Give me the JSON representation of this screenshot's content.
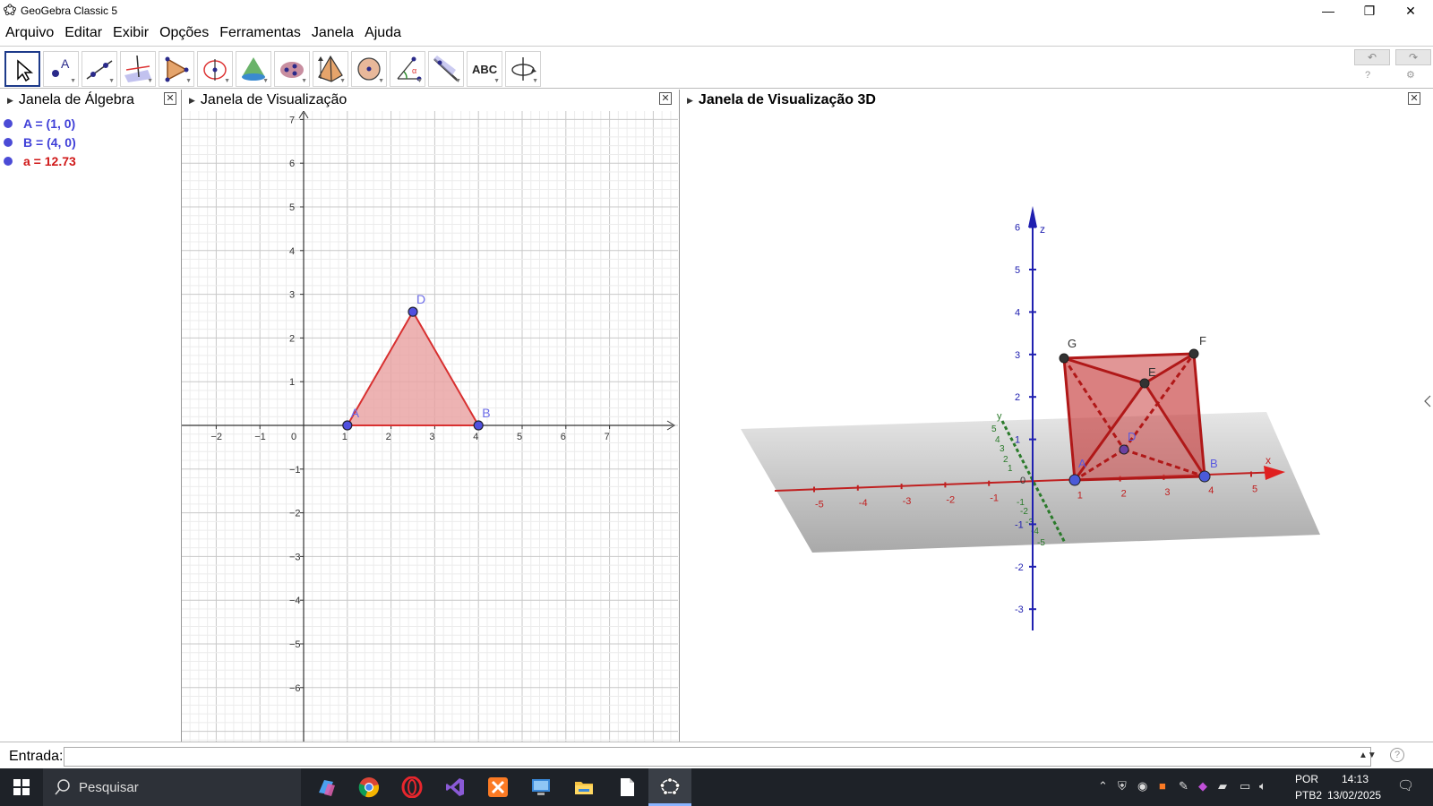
{
  "window": {
    "title": "GeoGebra Classic 5",
    "minimize": "—",
    "maximize": "❐",
    "close": "✕"
  },
  "menu": [
    "Arquivo",
    "Editar",
    "Exibir",
    "Opções",
    "Ferramentas",
    "Janela",
    "Ajuda"
  ],
  "toolbar": {
    "tools": [
      {
        "name": "move-tool-icon",
        "selected": true
      },
      {
        "name": "point-tool-icon"
      },
      {
        "name": "line-tool-icon"
      },
      {
        "name": "perpendicular-tool-icon"
      },
      {
        "name": "polygon-tool-icon"
      },
      {
        "name": "circle-tool-icon"
      },
      {
        "name": "cone-tool-icon"
      },
      {
        "name": "sphere-tool-icon"
      },
      {
        "name": "pyramid-tool-icon"
      },
      {
        "name": "circle-point-tool-icon"
      },
      {
        "name": "angle-tool-icon"
      },
      {
        "name": "reflect-tool-icon"
      },
      {
        "name": "text-tool-icon",
        "label": "ABC"
      },
      {
        "name": "rotate-view-tool-icon"
      }
    ],
    "undo": "↶",
    "redo": "↷",
    "help": "?",
    "settings": "⚙"
  },
  "panels": {
    "algebra": {
      "title": "Janela de Álgebra"
    },
    "graphics2d": {
      "title": "Janela de Visualização"
    },
    "graphics3d": {
      "title": "Janela de Visualização 3D"
    }
  },
  "algebra_items": [
    {
      "text": "A = (1, 0)",
      "color": "#4040d8"
    },
    {
      "text": "B = (4, 0)",
      "color": "#4040d8"
    },
    {
      "text": "a = 12.73",
      "color": "#d01818"
    }
  ],
  "graphics2d": {
    "x_ticks": [
      "−2",
      "−1",
      "0",
      "1",
      "2",
      "3",
      "4",
      "5",
      "6",
      "7"
    ],
    "y_ticks": [
      "7",
      "6",
      "5",
      "4",
      "3",
      "2",
      "1",
      "−1",
      "−2",
      "−3",
      "−4",
      "−5",
      "−6"
    ],
    "points": [
      {
        "label": "A",
        "x": 1,
        "y": 0
      },
      {
        "label": "B",
        "x": 4,
        "y": 0
      },
      {
        "label": "D",
        "x": 2.5,
        "y": 2.6
      }
    ],
    "fill_color": "#e8a0a0",
    "edge_color": "#d83030",
    "point_color": "#5050e0"
  },
  "graphics3d": {
    "axis_labels": {
      "x": "x",
      "y": "y",
      "z": "z"
    },
    "x_ticks": [
      "-5",
      "-4",
      "-3",
      "-2",
      "-1",
      "1",
      "2",
      "3",
      "4",
      "5"
    ],
    "y_ticks": [
      "5",
      "4",
      "3",
      "2",
      "1",
      "-1",
      "-2",
      "-3",
      "-4",
      "-5"
    ],
    "z_ticks": [
      "6",
      "5",
      "4",
      "3",
      "2",
      "1",
      "-1",
      "-2",
      "-3"
    ],
    "origin": "0",
    "vertex_labels": [
      "G",
      "F",
      "E",
      "D",
      "A",
      "B"
    ],
    "solid_color": "#c84040"
  },
  "input": {
    "label": "Entrada:",
    "value": "",
    "spin": "▲▼",
    "help": "?"
  },
  "taskbar": {
    "search_placeholder": "Pesquisar",
    "apps": [
      "copilot-icon",
      "chrome-icon",
      "opera-icon",
      "visual-studio-icon",
      "xampp-icon",
      "remote-desktop-icon",
      "file-explorer-icon",
      "notepad-icon",
      "geogebra-icon"
    ],
    "lang_top": "POR",
    "lang_bottom": "PTB2",
    "time": "14:13",
    "date": "13/02/2025"
  }
}
